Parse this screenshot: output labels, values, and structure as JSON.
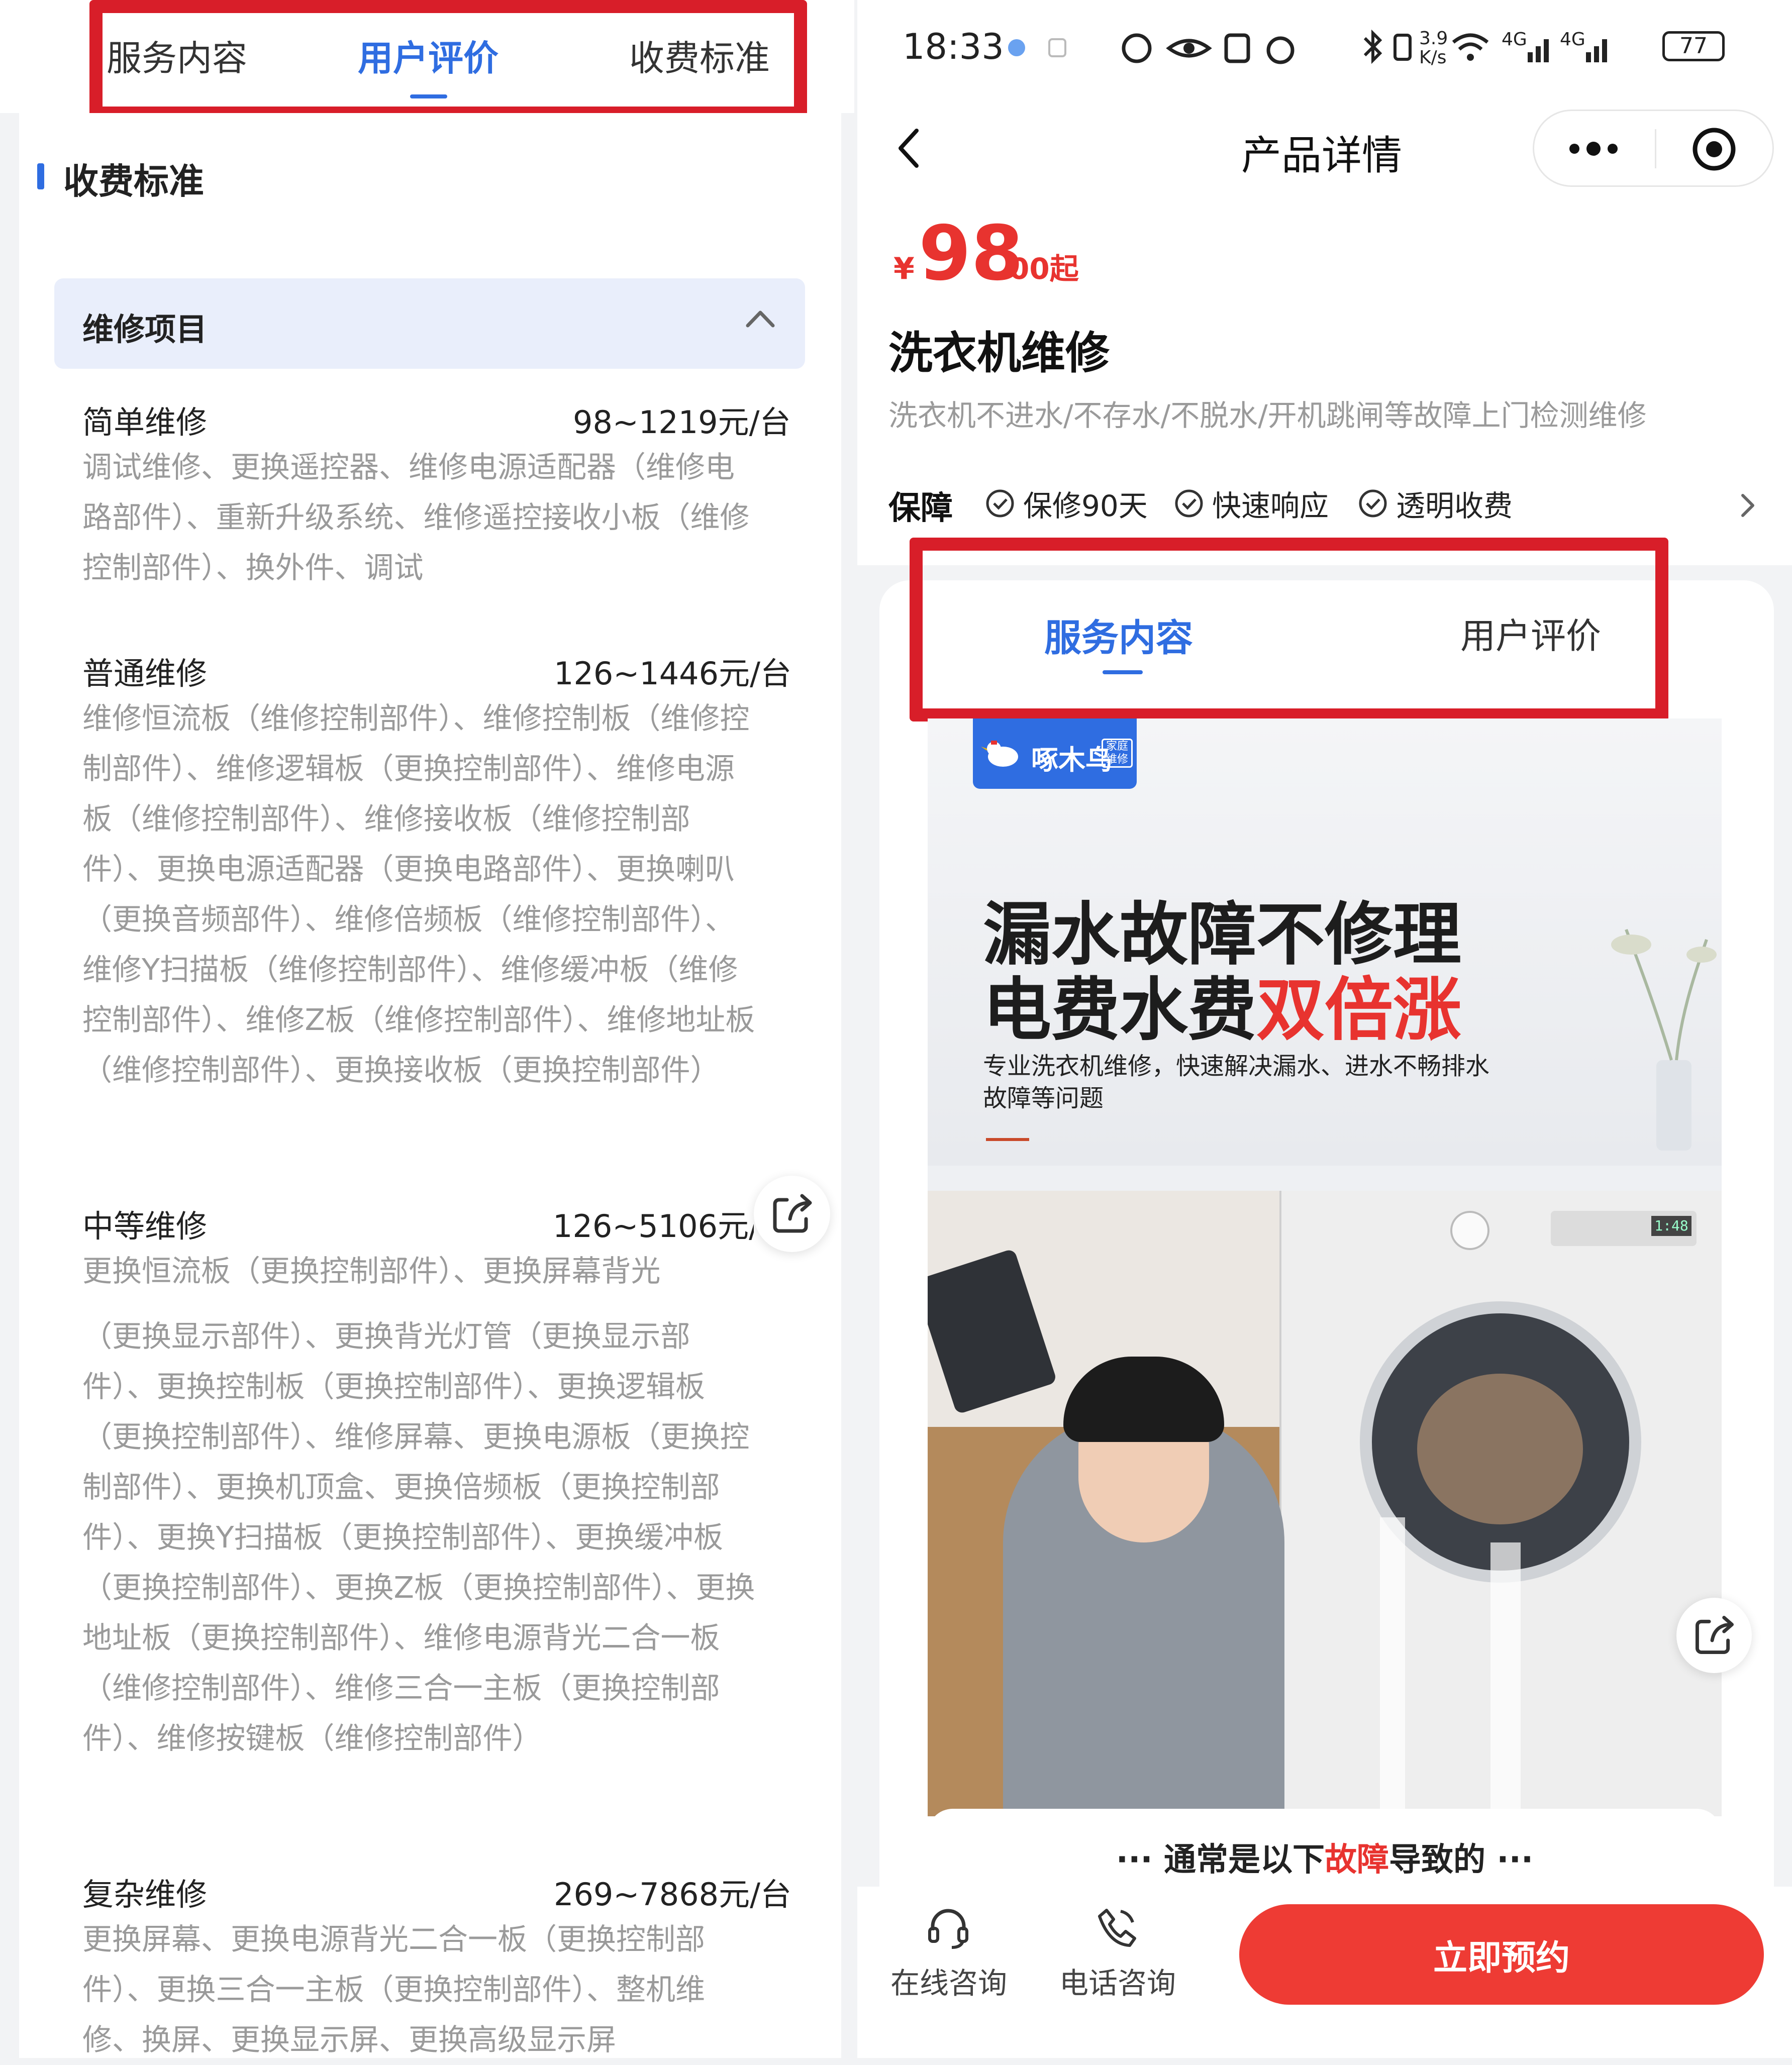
{
  "left_panel": {
    "tabs": [
      {
        "label": "服务内容",
        "active": false
      },
      {
        "label": "用户评价",
        "active": true
      },
      {
        "label": "收费标准",
        "active": false
      }
    ],
    "section_title": "收费标准",
    "accordion_title": "维修项目",
    "items": [
      {
        "name": "简单维修",
        "price": "98~1219元/台",
        "description": "调试维修、更换遥控器、维修电源适配器（维修电路部件）、重新升级系统、维修遥控接收小板（维修控制部件）、换外件、调试"
      },
      {
        "name": "普通维修",
        "price": "126~1446元/台",
        "description": "维修恒流板（维修控制部件）、维修控制板（维修控制部件）、维修逻辑板（更换控制部件）、维修电源板（维修控制部件）、维修接收板（维修控制部件）、更换电源适配器（更换电路部件）、更换喇叭（更换音频部件）、维修倍频板（维修控制部件）、维修Y扫描板（维修控制部件）、维修缓冲板（维修控制部件）、维修Z板（维修控制部件）、维修地址板（维修控制部件）、更换接收板（更换控制部件）"
      },
      {
        "name": "中等维修",
        "price": "126~5106元/台",
        "description_first": "更换恒流板（更换控制部件）、更换屏幕背光",
        "description_rest": "（更换显示部件）、更换背光灯管（更换显示部件）、更换控制板（更换控制部件）、更换逻辑板（更换控制部件）、维修屏幕、更换电源板（更换控制部件）、更换机顶盒、更换倍频板（更换控制部件）、更换Y扫描板（更换控制部件）、更换缓冲板（更换控制部件）、更换Z板（更换控制部件）、更换地址板（更换控制部件）、维修电源背光二合一板（维修控制部件）、维修三合一主板（更换控制部件）、维修按键板（维修控制部件）"
      },
      {
        "name": "复杂维修",
        "price": "269~7868元/台",
        "description": "更换屏幕、更换电源背光二合一板（更换控制部件）、更换三合一主板（更换控制部件）、整机维修、换屏、更换显示屏、更换高级显示屏"
      }
    ],
    "icons": {
      "share": "share-icon",
      "chevron": "chevron-up-icon"
    }
  },
  "right_panel": {
    "status_bar": {
      "time": "18:33",
      "speed_top": "3.9",
      "speed_bottom": "K/s",
      "net1": "4G",
      "net2": "4G",
      "battery": "77"
    },
    "nav": {
      "title": "产品详情"
    },
    "price": {
      "symbol": "¥",
      "integer": "98",
      "decimal": ".00起"
    },
    "product_title": "洗衣机维修",
    "product_subtitle": "洗衣机不进水/不存水/不脱水/开机跳闸等故障上门检测维修",
    "guarantee": {
      "label": "保障",
      "items": [
        "保修90天",
        "快速响应",
        "透明收费"
      ]
    },
    "tabs": [
      {
        "label": "服务内容",
        "active": true
      },
      {
        "label": "用户评价",
        "active": false
      }
    ],
    "banner": {
      "logo_text": "啄木鸟",
      "logo_sub": "家庭维修",
      "headline_line1": "漏水故障不修理",
      "headline_line2_plain": "电费水费",
      "headline_line2_accent": "双倍涨",
      "subtext": "专业洗衣机维修，快速解决漏水、进水不畅排水故障等问题",
      "display_reading": "1:48"
    },
    "cause_text_prefix": "··· 通常是以下",
    "cause_text_accent": "故障",
    "cause_text_suffix": "导致的 ···",
    "bottom_bar": {
      "online": "在线咨询",
      "phone": "电话咨询",
      "book": "立即预约"
    },
    "colors": {
      "accent_red": "#e8332f",
      "tab_blue": "#2f6de1",
      "highlight_box": "#d81e29"
    }
  }
}
